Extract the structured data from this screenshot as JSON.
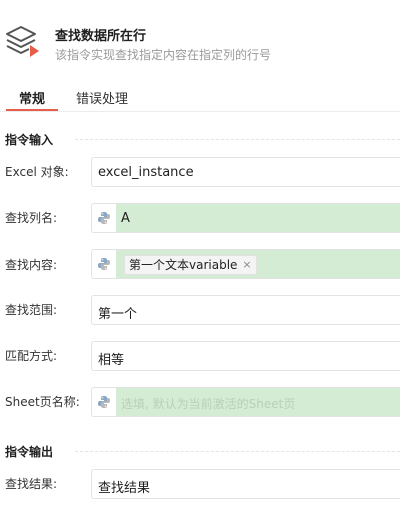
{
  "header": {
    "title": "查找数据所在行",
    "description": "该指令实现查找指定内容在指定列的行号",
    "icon": "layers-stack-icon"
  },
  "tabs": [
    {
      "label": "常规",
      "active": true
    },
    {
      "label": "错误处理",
      "active": false
    }
  ],
  "sections": {
    "input": "指令输入",
    "output": "指令输出"
  },
  "form": {
    "excel_object": {
      "label": "Excel 对象:",
      "value": "excel_instance"
    },
    "search_column": {
      "label": "查找列名:",
      "value": "A"
    },
    "search_content": {
      "label": "查找内容:",
      "chip": "第一个文本variable",
      "chip_close": "×"
    },
    "search_range": {
      "label": "查找范围:",
      "value": "第一个"
    },
    "match_mode": {
      "label": "匹配方式:",
      "value": "相等"
    },
    "sheet_name": {
      "label": "Sheet页名称:",
      "placeholder": "选填, 默认为当前激活的Sheet页"
    },
    "search_result": {
      "label": "查找结果:",
      "value": "查找结果"
    }
  },
  "colors": {
    "accent": "#e85d4a",
    "expression_bg": "#d5ecd4",
    "python_blue": "#8aa6c8",
    "python_gray": "#b8b8b8"
  }
}
